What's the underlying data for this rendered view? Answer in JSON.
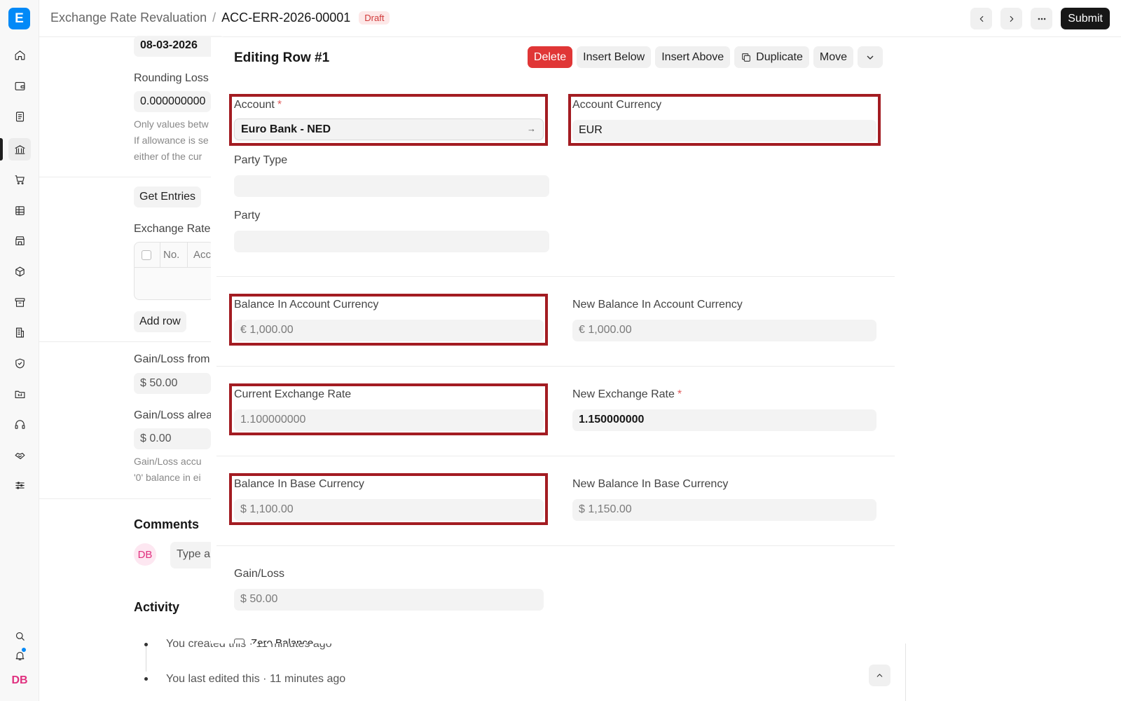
{
  "app": {
    "logo_letter": "E",
    "user_initials": "DB"
  },
  "sidebar": {
    "icons": [
      "home-icon",
      "wallet-icon",
      "document-icon",
      "bank-icon",
      "cart-icon",
      "table-icon",
      "store-icon",
      "package-icon",
      "archive-icon",
      "building-icon",
      "shield-icon",
      "folder-icon",
      "headset-icon",
      "handshake-icon",
      "sliders-icon"
    ],
    "active_index": 3,
    "bottom_icons": [
      "search-icon",
      "bell-icon"
    ]
  },
  "header": {
    "breadcrumb_parent": "Exchange Rate Revaluation",
    "breadcrumb_sep": "/",
    "breadcrumb_current": "ACC-ERR-2026-00001",
    "status": "Draft",
    "submit_label": "Submit"
  },
  "background_form": {
    "posting_date": "08-03-2026",
    "rounding_loss_label": "Rounding Loss",
    "rounding_loss_value": "0.000000000",
    "help_line1": "Only values betw",
    "help_line2": "If allowance is se",
    "help_line3": "either of the cur",
    "get_entries_label": "Get Entries",
    "exchange_rate_label": "Exchange Rate",
    "grid_no_label": "No.",
    "grid_account_label": "Acc",
    "add_row_label": "Add row",
    "gain_loss_from_label": "Gain/Loss from",
    "gain_loss_from_value": "$ 50.00",
    "gain_loss_already_label": "Gain/Loss alrea",
    "gain_loss_already_value": "$ 0.00",
    "gain_loss_help1": "Gain/Loss accu",
    "gain_loss_help2": "'0' balance in ei",
    "comments_title": "Comments",
    "comment_avatar": "DB",
    "comment_placeholder": "Type a",
    "activity_title": "Activity",
    "activity_1": "You created this · 11 minutes ago",
    "activity_2": "You last edited this · 11 minutes ago"
  },
  "panel": {
    "title": "Editing Row #1",
    "actions": {
      "delete": "Delete",
      "insert_below": "Insert Below",
      "insert_above": "Insert Above",
      "duplicate": "Duplicate",
      "move": "Move"
    },
    "fields": {
      "account_label": "Account",
      "account_value": "Euro Bank - NED",
      "account_currency_label": "Account Currency",
      "account_currency_value": "EUR",
      "party_type_label": "Party Type",
      "party_type_value": "",
      "party_label": "Party",
      "party_value": "",
      "balance_account_currency_label": "Balance In Account Currency",
      "balance_account_currency_value": "€ 1,000.00",
      "new_balance_account_currency_label": "New Balance In Account Currency",
      "new_balance_account_currency_value": "€ 1,000.00",
      "current_exchange_rate_label": "Current Exchange Rate",
      "current_exchange_rate_value": "1.100000000",
      "new_exchange_rate_label": "New Exchange Rate",
      "new_exchange_rate_value": "1.150000000",
      "balance_base_currency_label": "Balance In Base Currency",
      "balance_base_currency_value": "$ 1,100.00",
      "new_balance_base_currency_label": "New Balance In Base Currency",
      "new_balance_base_currency_value": "$ 1,150.00",
      "gain_loss_label": "Gain/Loss",
      "gain_loss_value": "$ 50.00",
      "zero_balance_label": "Zero Balance",
      "required_mark": "*"
    }
  },
  "colors": {
    "brand": "#0289f7",
    "danger": "#e03636",
    "highlight": "#a31c22",
    "draft_badge_bg": "#fde8e8",
    "draft_badge_text": "#d03a3a",
    "avatar_text": "#e0307f"
  }
}
